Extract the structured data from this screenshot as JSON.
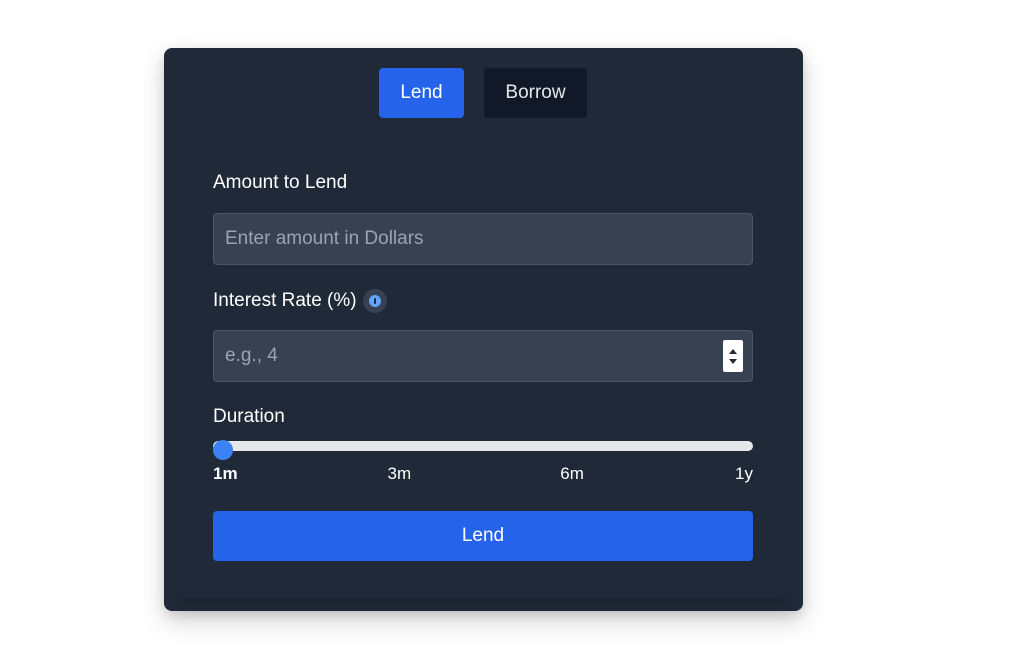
{
  "tabs": [
    {
      "label": "Lend",
      "active": true
    },
    {
      "label": "Borrow",
      "active": false
    }
  ],
  "form": {
    "amount": {
      "label": "Amount to Lend",
      "placeholder": "Enter amount in Dollars",
      "value": ""
    },
    "interest": {
      "label": "Interest Rate (%)",
      "placeholder": "e.g., 4",
      "value": "",
      "info_icon": "info-icon"
    },
    "duration": {
      "label": "Duration",
      "ticks": [
        "1m",
        "3m",
        "6m",
        "1y"
      ],
      "selected": "1m",
      "selected_index": 0
    },
    "submit_label": "Lend"
  },
  "colors": {
    "card_bg": "#1f2937",
    "accent": "#2563eb",
    "slider_thumb": "#3b82f6",
    "input_bg": "#374151",
    "inactive_tab_bg": "#111827"
  }
}
